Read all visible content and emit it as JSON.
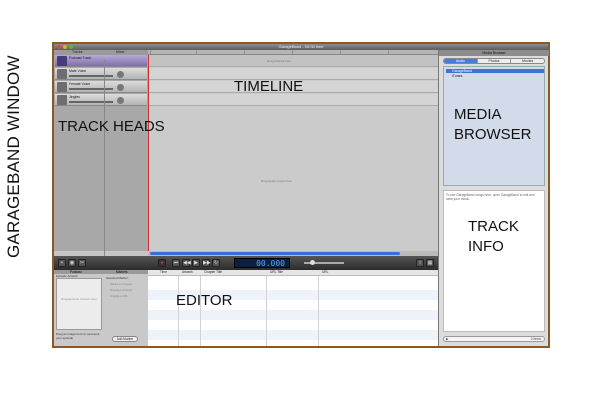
{
  "annotations": {
    "side_label": "GARAGEBAND WINDOW",
    "timeline": "TIMELINE",
    "track_heads": "TRACK HEADS",
    "media_browser_line1": "MEDIA",
    "media_browser_line2": "BROWSER",
    "track_info_line1": "TRACK",
    "track_info_line2": "INFO",
    "editor": "EDITOR"
  },
  "window": {
    "title": "GarageBand - 00:00 time"
  },
  "header": {
    "tracks_label": "Tracks",
    "mixer_label": "Mixer"
  },
  "tracks": [
    {
      "name": "Podcast Track"
    },
    {
      "name": "Male Voice"
    },
    {
      "name": "Female Voice"
    },
    {
      "name": "Jingles"
    }
  ],
  "timeline": {
    "artwork_hint": "Drag Artwork here",
    "drop_hint": "Drag Apple Loops here"
  },
  "transport": {
    "time": "00.000"
  },
  "editor": {
    "left_header": "Podcast",
    "markers_header": "Markers",
    "episode_artwork": "Episode Artwork",
    "artwork_hint": "Drag Episode Artwork here",
    "hint_below": "Drag an image here to represent your episode",
    "selected_marker": "Selected Marker:",
    "options": [
      "Marks a Chapter",
      "Displays Artwork",
      "Displays URL"
    ],
    "add_marker": "Add Marker",
    "columns": [
      "Time",
      "Artwork",
      "Chapter Title",
      "URL Title",
      "URL"
    ]
  },
  "media_browser": {
    "title": "Media Browser",
    "tabs": [
      "Audio",
      "Photos",
      "Movies"
    ],
    "items": [
      "GarageBand",
      "iTunes"
    ],
    "track_info_text": "To use GarageBand songs here, open GarageBand to edit and save your music.",
    "item_count": "0 items"
  },
  "colors": {
    "window_border": "#8a5a26",
    "accent_blue": "#3f72d6",
    "playhead": "#cc3333"
  }
}
